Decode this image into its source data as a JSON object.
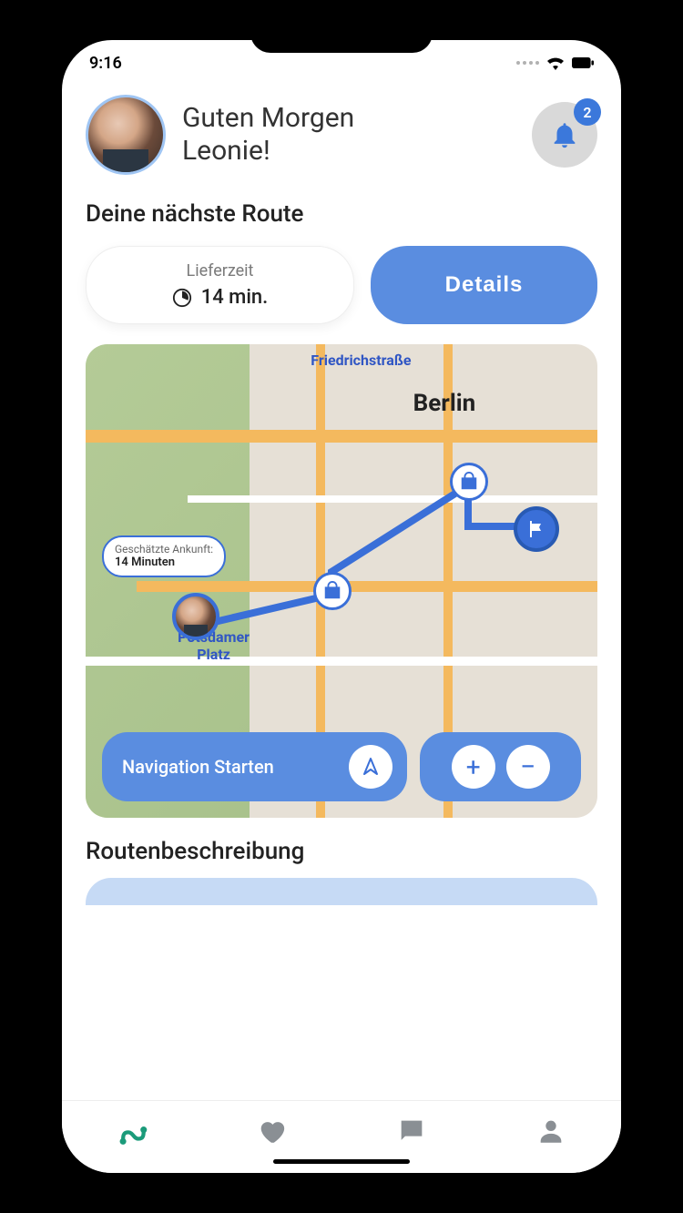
{
  "status": {
    "time": "9:16"
  },
  "header": {
    "greeting_line1": "Guten Morgen",
    "greeting_line2": "Leonie!",
    "notification_count": "2"
  },
  "next_route": {
    "heading": "Deine nächste Route",
    "delivery_label": "Lieferzeit",
    "delivery_value": "14 min.",
    "details_label": "Details"
  },
  "map": {
    "label_friedrich": "Friedrichstraße",
    "label_berlin": "Berlin",
    "label_potsdamer_l1": "Potsdamer",
    "label_potsdamer_l2": "Platz",
    "eta_title": "Geschätzte Ankunft:",
    "eta_value": "14 Minuten",
    "nav_start_label": "Navigation Starten",
    "zoom_in": "+",
    "zoom_out": "−"
  },
  "route_desc": {
    "heading": "Routenbeschreibung"
  },
  "colors": {
    "primary": "#5a8de0",
    "accent": "#3a6fd8"
  }
}
